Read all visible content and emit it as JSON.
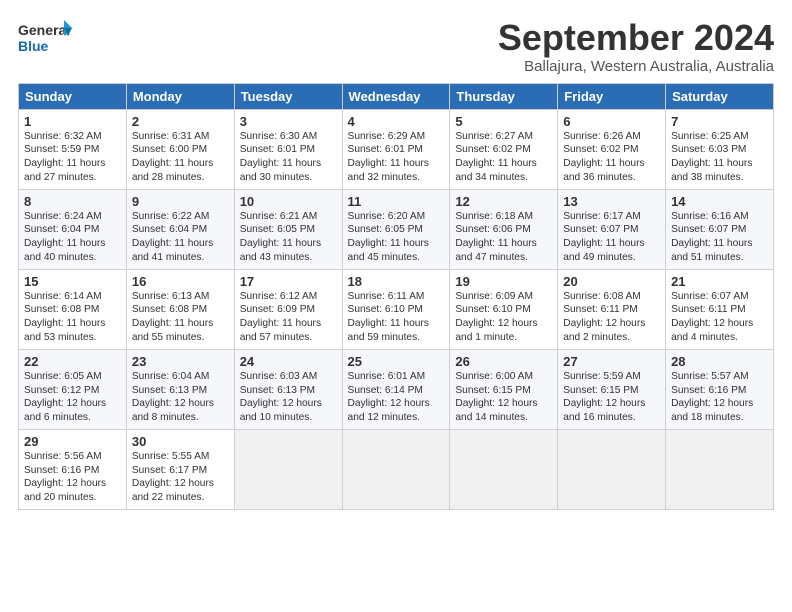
{
  "logo": {
    "line1": "General",
    "line2": "Blue"
  },
  "title": "September 2024",
  "subtitle": "Ballajura, Western Australia, Australia",
  "weekdays": [
    "Sunday",
    "Monday",
    "Tuesday",
    "Wednesday",
    "Thursday",
    "Friday",
    "Saturday"
  ],
  "weeks": [
    [
      {
        "day": "1",
        "lines": [
          "Sunrise: 6:32 AM",
          "Sunset: 5:59 PM",
          "Daylight: 11 hours",
          "and 27 minutes."
        ]
      },
      {
        "day": "2",
        "lines": [
          "Sunrise: 6:31 AM",
          "Sunset: 6:00 PM",
          "Daylight: 11 hours",
          "and 28 minutes."
        ]
      },
      {
        "day": "3",
        "lines": [
          "Sunrise: 6:30 AM",
          "Sunset: 6:01 PM",
          "Daylight: 11 hours",
          "and 30 minutes."
        ]
      },
      {
        "day": "4",
        "lines": [
          "Sunrise: 6:29 AM",
          "Sunset: 6:01 PM",
          "Daylight: 11 hours",
          "and 32 minutes."
        ]
      },
      {
        "day": "5",
        "lines": [
          "Sunrise: 6:27 AM",
          "Sunset: 6:02 PM",
          "Daylight: 11 hours",
          "and 34 minutes."
        ]
      },
      {
        "day": "6",
        "lines": [
          "Sunrise: 6:26 AM",
          "Sunset: 6:02 PM",
          "Daylight: 11 hours",
          "and 36 minutes."
        ]
      },
      {
        "day": "7",
        "lines": [
          "Sunrise: 6:25 AM",
          "Sunset: 6:03 PM",
          "Daylight: 11 hours",
          "and 38 minutes."
        ]
      }
    ],
    [
      {
        "day": "8",
        "lines": [
          "Sunrise: 6:24 AM",
          "Sunset: 6:04 PM",
          "Daylight: 11 hours",
          "and 40 minutes."
        ]
      },
      {
        "day": "9",
        "lines": [
          "Sunrise: 6:22 AM",
          "Sunset: 6:04 PM",
          "Daylight: 11 hours",
          "and 41 minutes."
        ]
      },
      {
        "day": "10",
        "lines": [
          "Sunrise: 6:21 AM",
          "Sunset: 6:05 PM",
          "Daylight: 11 hours",
          "and 43 minutes."
        ]
      },
      {
        "day": "11",
        "lines": [
          "Sunrise: 6:20 AM",
          "Sunset: 6:05 PM",
          "Daylight: 11 hours",
          "and 45 minutes."
        ]
      },
      {
        "day": "12",
        "lines": [
          "Sunrise: 6:18 AM",
          "Sunset: 6:06 PM",
          "Daylight: 11 hours",
          "and 47 minutes."
        ]
      },
      {
        "day": "13",
        "lines": [
          "Sunrise: 6:17 AM",
          "Sunset: 6:07 PM",
          "Daylight: 11 hours",
          "and 49 minutes."
        ]
      },
      {
        "day": "14",
        "lines": [
          "Sunrise: 6:16 AM",
          "Sunset: 6:07 PM",
          "Daylight: 11 hours",
          "and 51 minutes."
        ]
      }
    ],
    [
      {
        "day": "15",
        "lines": [
          "Sunrise: 6:14 AM",
          "Sunset: 6:08 PM",
          "Daylight: 11 hours",
          "and 53 minutes."
        ]
      },
      {
        "day": "16",
        "lines": [
          "Sunrise: 6:13 AM",
          "Sunset: 6:08 PM",
          "Daylight: 11 hours",
          "and 55 minutes."
        ]
      },
      {
        "day": "17",
        "lines": [
          "Sunrise: 6:12 AM",
          "Sunset: 6:09 PM",
          "Daylight: 11 hours",
          "and 57 minutes."
        ]
      },
      {
        "day": "18",
        "lines": [
          "Sunrise: 6:11 AM",
          "Sunset: 6:10 PM",
          "Daylight: 11 hours",
          "and 59 minutes."
        ]
      },
      {
        "day": "19",
        "lines": [
          "Sunrise: 6:09 AM",
          "Sunset: 6:10 PM",
          "Daylight: 12 hours",
          "and 1 minute."
        ]
      },
      {
        "day": "20",
        "lines": [
          "Sunrise: 6:08 AM",
          "Sunset: 6:11 PM",
          "Daylight: 12 hours",
          "and 2 minutes."
        ]
      },
      {
        "day": "21",
        "lines": [
          "Sunrise: 6:07 AM",
          "Sunset: 6:11 PM",
          "Daylight: 12 hours",
          "and 4 minutes."
        ]
      }
    ],
    [
      {
        "day": "22",
        "lines": [
          "Sunrise: 6:05 AM",
          "Sunset: 6:12 PM",
          "Daylight: 12 hours",
          "and 6 minutes."
        ]
      },
      {
        "day": "23",
        "lines": [
          "Sunrise: 6:04 AM",
          "Sunset: 6:13 PM",
          "Daylight: 12 hours",
          "and 8 minutes."
        ]
      },
      {
        "day": "24",
        "lines": [
          "Sunrise: 6:03 AM",
          "Sunset: 6:13 PM",
          "Daylight: 12 hours",
          "and 10 minutes."
        ]
      },
      {
        "day": "25",
        "lines": [
          "Sunrise: 6:01 AM",
          "Sunset: 6:14 PM",
          "Daylight: 12 hours",
          "and 12 minutes."
        ]
      },
      {
        "day": "26",
        "lines": [
          "Sunrise: 6:00 AM",
          "Sunset: 6:15 PM",
          "Daylight: 12 hours",
          "and 14 minutes."
        ]
      },
      {
        "day": "27",
        "lines": [
          "Sunrise: 5:59 AM",
          "Sunset: 6:15 PM",
          "Daylight: 12 hours",
          "and 16 minutes."
        ]
      },
      {
        "day": "28",
        "lines": [
          "Sunrise: 5:57 AM",
          "Sunset: 6:16 PM",
          "Daylight: 12 hours",
          "and 18 minutes."
        ]
      }
    ],
    [
      {
        "day": "29",
        "lines": [
          "Sunrise: 5:56 AM",
          "Sunset: 6:16 PM",
          "Daylight: 12 hours",
          "and 20 minutes."
        ]
      },
      {
        "day": "30",
        "lines": [
          "Sunrise: 5:55 AM",
          "Sunset: 6:17 PM",
          "Daylight: 12 hours",
          "and 22 minutes."
        ]
      },
      {
        "day": "",
        "lines": []
      },
      {
        "day": "",
        "lines": []
      },
      {
        "day": "",
        "lines": []
      },
      {
        "day": "",
        "lines": []
      },
      {
        "day": "",
        "lines": []
      }
    ]
  ]
}
